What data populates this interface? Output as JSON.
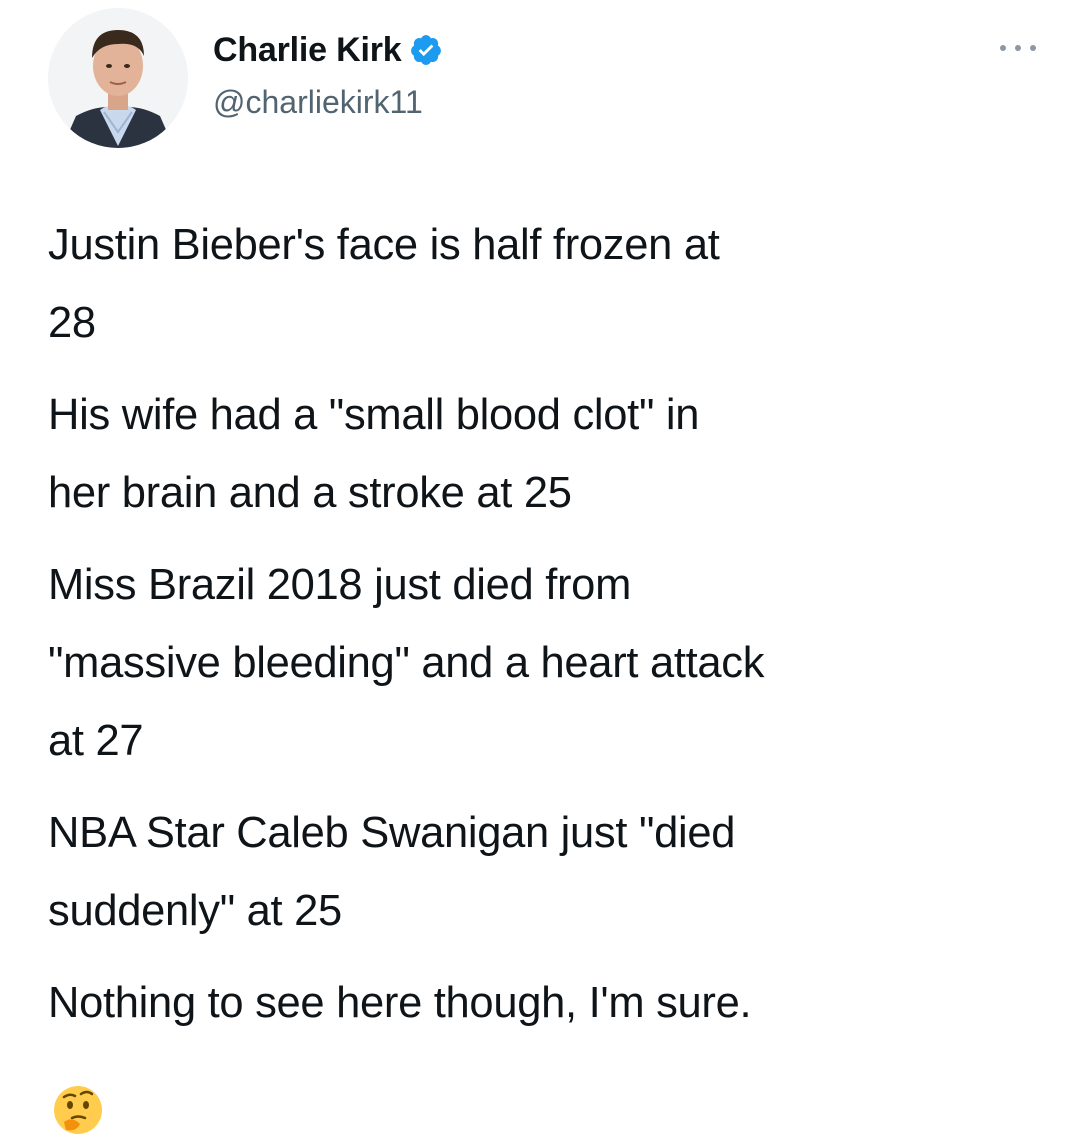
{
  "tweet": {
    "author": {
      "display_name": "Charlie Kirk",
      "handle": "@charliekirk11",
      "verified": true,
      "avatar_icon": "profile-photo-icon"
    },
    "more_icon": "more-options-icon",
    "paragraphs": [
      {
        "lines": [
          "Justin Bieber's face is half frozen at",
          "28"
        ]
      },
      {
        "lines": [
          "His wife had a \"small blood clot\" in",
          "her brain and a stroke at 25"
        ]
      },
      {
        "lines": [
          "Miss Brazil 2018 just died from",
          "\"massive bleeding\" and a heart attack",
          "at 27"
        ]
      },
      {
        "lines": [
          "NBA Star Caleb Swanigan just \"died",
          "suddenly\" at 25"
        ]
      },
      {
        "lines": [
          "Nothing to see here though, I'm sure."
        ]
      }
    ],
    "emoji": "thinking-face-emoji"
  },
  "colors": {
    "text": "#0f1419",
    "secondary": "#536471",
    "verified": "#1d9bf0"
  }
}
